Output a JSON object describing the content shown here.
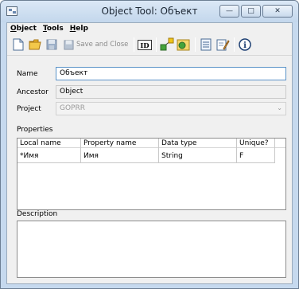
{
  "window": {
    "title": "Object Tool: Объект"
  },
  "caption": {
    "minimize": "—",
    "maximize": "□",
    "close": "✕"
  },
  "menu": [
    {
      "label": "Object",
      "accel": "O"
    },
    {
      "label": "Tools",
      "accel": "T"
    },
    {
      "label": "Help",
      "accel": "H"
    }
  ],
  "toolbar": {
    "save_close_label": "Save and Close",
    "id_label": "ID",
    "info_label": "i"
  },
  "form": {
    "name_label": "Name",
    "name_value": "Объект",
    "ancestor_label": "Ancestor",
    "ancestor_value": "Object",
    "project_label": "Project",
    "project_value": "GOPRR"
  },
  "properties": {
    "label": "Properties",
    "columns": [
      "Local name",
      "Property name",
      "Data type",
      "Unique?"
    ],
    "rows": [
      {
        "local_name": "*Имя",
        "property_name": "Имя",
        "data_type": "String",
        "unique": "F"
      }
    ]
  },
  "description": {
    "label": "Description",
    "value": ""
  },
  "colors": {
    "titlebar": "#c6d9ee",
    "client": "#f0f0f0",
    "focus_border": "#5b93c8"
  }
}
